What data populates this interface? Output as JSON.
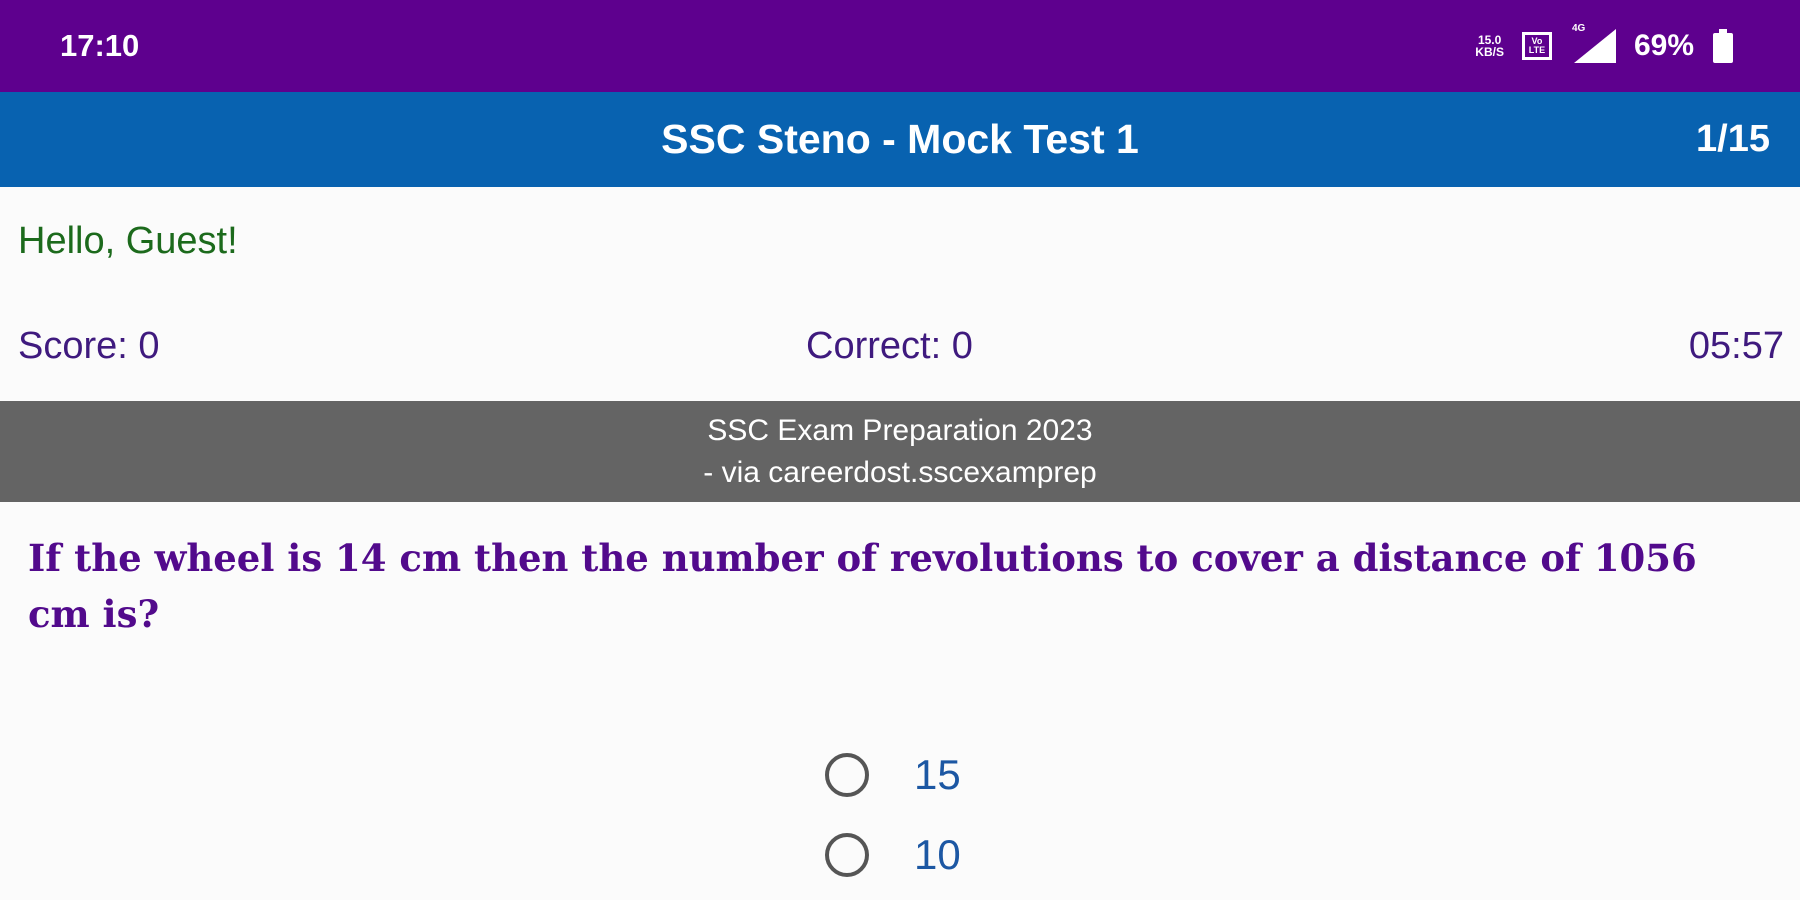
{
  "status_bar": {
    "time": "17:10",
    "network_speed_value": "15.0",
    "network_speed_unit": "KB/S",
    "volte_label": "Vo LTE",
    "network_type": "4G",
    "battery_percent": "69%",
    "icons": [
      "volte-icon",
      "signal-icon",
      "battery-icon"
    ]
  },
  "app_bar": {
    "title": "SSC Steno - Mock Test 1",
    "progress": "1/15"
  },
  "greeting": "Hello, Guest!",
  "stats": {
    "score": "Score: 0",
    "correct": "Correct: 0",
    "timer": "05:57"
  },
  "banner": {
    "line1": "SSC Exam Preparation 2023",
    "line2": "- via careerdost.sscexamprep"
  },
  "question": {
    "text": "If the wheel is 14 cm then the number of revolutions to cover a distance of 1056 cm is?"
  },
  "options": [
    {
      "label": "15",
      "selected": false
    },
    {
      "label": "10",
      "selected": false
    }
  ],
  "colors": {
    "status_bar": "#5e008e",
    "app_bar": "#0862b0",
    "greeting": "#1c6a1c",
    "stats": "#3f1a7e",
    "banner": "#646464",
    "question": "#520a8c",
    "option_label": "#1c57a3"
  }
}
